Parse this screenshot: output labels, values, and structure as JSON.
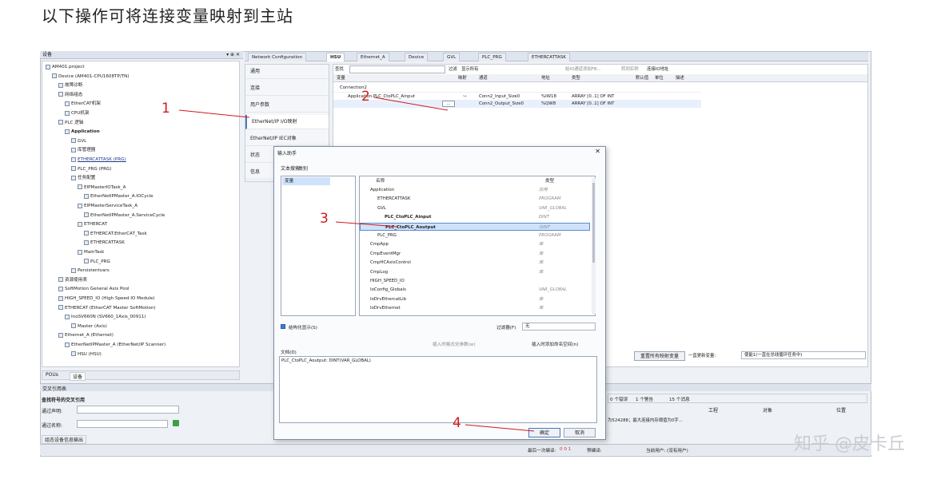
{
  "heading": "以下操作可将连接变量映射到主站",
  "device_panel": {
    "header": "设备",
    "pin": "▾ ⊕ ✕",
    "tree": [
      {
        "label": "AM401.project",
        "level": 0
      },
      {
        "label": "Device (AM401-CPU1608TP/TN)",
        "level": 1
      },
      {
        "label": "故障诊断",
        "level": 2
      },
      {
        "label": "网络组态",
        "level": 2
      },
      {
        "label": "EtherCAT机架",
        "level": 3
      },
      {
        "label": "CPU机架",
        "level": 3
      },
      {
        "label": "PLC 逻辑",
        "level": 2
      },
      {
        "label": "Application",
        "level": 3,
        "style": "bold"
      },
      {
        "label": "GVL",
        "level": 4
      },
      {
        "label": "库管理器",
        "level": 4
      },
      {
        "label": "ETHERCATTASK (PRG)",
        "level": 4,
        "style": "ul"
      },
      {
        "label": "PLC_PRG (PRG)",
        "level": 4
      },
      {
        "label": "任务配置",
        "level": 4
      },
      {
        "label": "EIPMasterIOTask_A",
        "level": 5
      },
      {
        "label": "EtherNetIPMaster_A.IOCycle",
        "level": 6
      },
      {
        "label": "EIPMasterServiceTask_A",
        "level": 5
      },
      {
        "label": "EtherNetIPMaster_A.ServiceCycle",
        "level": 6
      },
      {
        "label": "ETHERCAT",
        "level": 5
      },
      {
        "label": "ETHERCAT.EtherCAT_Task",
        "level": 6
      },
      {
        "label": "ETHERCATTASK",
        "level": 6
      },
      {
        "label": "MainTask",
        "level": 5
      },
      {
        "label": "PLC_PRG",
        "level": 6
      },
      {
        "label": "Persistentvars",
        "level": 4
      },
      {
        "label": "资源使用表",
        "level": 2
      },
      {
        "label": "SoftMotion General Axis Pool",
        "level": 2
      },
      {
        "label": "HIGH_SPEED_IO (High Speed IO Module)",
        "level": 2
      },
      {
        "label": "ETHERCAT (EtherCAT Master SoftMotion)",
        "level": 2
      },
      {
        "label": "InoSV660N (SV660_1Axis_00911)",
        "level": 3
      },
      {
        "label": "Master (Axis)",
        "level": 4
      },
      {
        "label": "Ethernet_A (Ethernet)",
        "level": 2
      },
      {
        "label": "EtherNetIPMaster_A (EtherNet/IP Scanner)",
        "level": 3
      },
      {
        "label": "HSU (HSU)",
        "level": 4
      }
    ],
    "bottom_tabs": [
      "POUs",
      "设备"
    ]
  },
  "editor_tabs": [
    "Network Configuration",
    "HSU",
    "Ethernet_A",
    "Device",
    "GVL",
    "PLC_PRG",
    "ETHERCATTASK"
  ],
  "left_nav": [
    "通用",
    "连接",
    "用户参数",
    "EtherNet/IP I/O映射",
    "EtherNet/IP IEC对象",
    "状态",
    "信息"
  ],
  "left_nav_selected": 3,
  "grid": {
    "search_label": "查找",
    "filter_label": "过滤",
    "filter_value": "显示所有",
    "add_fb": "给IO通道添加FB...",
    "goto_instance": "转到实例",
    "io_mapping": "连接IO地址",
    "columns": [
      "变量",
      "映射",
      "通道",
      "地址",
      "类型",
      "默认值",
      "单位",
      "描述"
    ],
    "rows": [
      {
        "var": "Connection2",
        "map": "",
        "channel": "",
        "addr": "",
        "type": ""
      },
      {
        "var": "Application.PLC_CtoPLC_Ainput",
        "map": "↪",
        "channel": "Conn2_Input_Size0",
        "addr": "%IW18",
        "type": "ARRAY [0..1] OF INT"
      },
      {
        "var": "",
        "map": "...",
        "channel": "Conn2_Output_Size0",
        "addr": "%QW8",
        "type": "ARRAY [0..1] OF INT"
      }
    ],
    "reset_btn": "重置所有映射变量",
    "always_update": "一直更新变量:",
    "update_value": "使能1(一直在总线循环任务中)"
  },
  "dialog": {
    "title": "输入助手",
    "tabs": [
      "文本搜索",
      "类别"
    ],
    "category_left": "变量",
    "col_name": "名称",
    "col_type": "类型",
    "items": [
      {
        "label": "Application",
        "type": "应用",
        "indent": 1
      },
      {
        "label": "ETHERCATTASK",
        "type": "PROGRAM",
        "indent": 2
      },
      {
        "label": "GVL",
        "type": "VAR_GLOBAL",
        "indent": 2
      },
      {
        "label": "PLC_CtoPLC_Ainput",
        "type": "DINT",
        "indent": 3
      },
      {
        "label": "PLC_CtoPLC_Aoutput",
        "type": "DINT",
        "indent": 3,
        "highlight": true
      },
      {
        "label": "PLC_PRG",
        "type": "PROGRAM",
        "indent": 2
      },
      {
        "label": "CmpApp",
        "type": "库",
        "indent": 1
      },
      {
        "label": "CmpEventMgr",
        "type": "库",
        "indent": 1
      },
      {
        "label": "CmpHCAxisControl",
        "type": "库",
        "indent": 1
      },
      {
        "label": "CmpLog",
        "type": "库",
        "indent": 1
      },
      {
        "label": "HIGH_SPEED_IO",
        "type": "",
        "indent": 1
      },
      {
        "label": "IoConfig_Globals",
        "type": "VAR_GLOBAL",
        "indent": 1
      },
      {
        "label": "IoDrvEthercatLib",
        "type": "库",
        "indent": 1
      },
      {
        "label": "IoDrvEthernet",
        "type": "库",
        "indent": 1
      }
    ],
    "structured_view": "结构化显示(S)",
    "filter_label": "过滤器(F)",
    "filter_value": "无",
    "insert_args": "插入时格式化参数(w)",
    "insert_ns": "插入时添加命名空间(n)",
    "doc_label": "文档(D)",
    "doc_text": "PLC_CtoPLC_Aoutput: DINT(VAR_GLOBAL)",
    "ok": "确定",
    "cancel": "取消"
  },
  "cross_ref": {
    "header": "交叉引用表",
    "title": "查找符号的交叉引用",
    "by_declaration": "通过声明:",
    "by_name": "通过名称:"
  },
  "messages": {
    "errors": "0 个错误",
    "warnings": "1 个警告",
    "infos": "15 个消息",
    "col_project": "工程",
    "col_object": "对象",
    "col_position": "位置",
    "msg_text": "为524288；最大连接内存阈值为0字..."
  },
  "status_bar": {
    "last_compile": "最后一次编译:",
    "compile_value": "0 0 1",
    "precompile": "预编译:",
    "current_user": "当前用户: (没有用户)"
  },
  "bottom_left_tab": "组态设备信息输出",
  "annotations": [
    "1",
    "2",
    "3",
    "4"
  ],
  "watermark": "知乎 @皮卡丘",
  "colors": {
    "annotation": "#d11a1a",
    "selection": "#cfe2fb",
    "accent": "#4a78c0"
  }
}
